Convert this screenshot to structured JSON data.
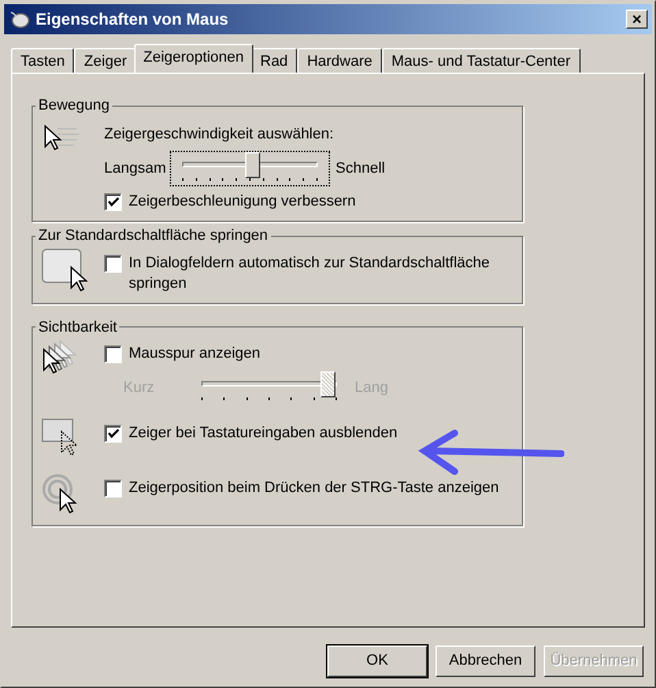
{
  "window": {
    "title": "Eigenschaften von Maus",
    "close": "×"
  },
  "tabs": [
    {
      "label": "Tasten",
      "selected": false
    },
    {
      "label": "Zeiger",
      "selected": false
    },
    {
      "label": "Zeigeroptionen",
      "selected": true
    },
    {
      "label": "Rad",
      "selected": false
    },
    {
      "label": "Hardware",
      "selected": false
    },
    {
      "label": "Maus- und Tastatur-Center",
      "selected": false
    }
  ],
  "groups": [
    {
      "title": "Bewegung",
      "rows": [
        {
          "items": [
            {
              "kind": "label",
              "text": "Zeigergeschwindigkeit auswählen:"
            },
            {
              "kind": "slider",
              "min_label": "Langsam",
              "max_label": "Schnell",
              "level": 0.52,
              "disabled": false,
              "focused": true
            },
            {
              "kind": "checkbox",
              "label": "Zeigerbeschleunigung verbessern",
              "checked": true
            }
          ]
        }
      ]
    },
    {
      "title": "Zur Standardschaltfläche springen",
      "rows": [
        {
          "items": [
            {
              "kind": "checkbox",
              "label": "In Dialogfeldern automatisch zur Standardschaltfläche springen",
              "checked": false
            }
          ]
        }
      ]
    },
    {
      "title": "Sichtbarkeit",
      "rows": [
        {
          "items": [
            {
              "kind": "checkbox",
              "label": "Mausspur anzeigen",
              "checked": false
            },
            {
              "kind": "slider",
              "min_label": "Kurz",
              "max_label": "Lang",
              "level": 1,
              "disabled": true,
              "focused": false
            }
          ]
        },
        {
          "items": [
            {
              "kind": "checkbox",
              "label": "Zeiger bei Tastatureingaben ausblenden",
              "checked": true
            }
          ]
        },
        {
          "items": [
            {
              "kind": "checkbox",
              "label": "Zeigerposition beim Drücken der STRG-Taste anzeigen",
              "checked": false
            }
          ]
        }
      ]
    }
  ],
  "buttons": [
    {
      "label": "OK",
      "default": true,
      "disabled": false
    },
    {
      "label": "Abbrechen",
      "default": false,
      "disabled": false
    },
    {
      "label": "Übernehmen",
      "default": false,
      "disabled": true
    }
  ]
}
